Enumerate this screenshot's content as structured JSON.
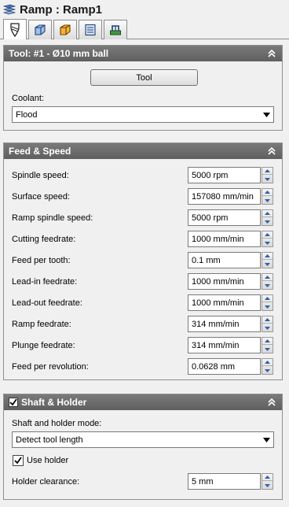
{
  "window": {
    "title": "Ramp : Ramp1",
    "icon": "ramp-layers-icon"
  },
  "tabs": [
    {
      "name": "tool-tab",
      "icon": "tool-bit-icon",
      "active": true
    },
    {
      "name": "geometry-tab",
      "icon": "cube-wireframe-icon",
      "active": false
    },
    {
      "name": "stock-tab",
      "icon": "stock-block-icon",
      "active": false
    },
    {
      "name": "passes-tab",
      "icon": "passes-list-icon",
      "active": false
    },
    {
      "name": "linking-tab",
      "icon": "linking-icon",
      "active": false
    }
  ],
  "tool_panel": {
    "header": "Tool: #1 - Ø10 mm ball",
    "tool_button": "Tool",
    "coolant_label": "Coolant:",
    "coolant_value": "Flood"
  },
  "feed_panel": {
    "header": "Feed & Speed",
    "rows": [
      {
        "label": "Spindle speed:",
        "value": "5000 rpm"
      },
      {
        "label": "Surface speed:",
        "value": "157080 mm/min"
      },
      {
        "label": "Ramp spindle speed:",
        "value": "5000 rpm"
      },
      {
        "label": "Cutting feedrate:",
        "value": "1000 mm/min"
      },
      {
        "label": "Feed per tooth:",
        "value": "0.1 mm"
      },
      {
        "label": "Lead-in feedrate:",
        "value": "1000 mm/min"
      },
      {
        "label": "Lead-out feedrate:",
        "value": "1000 mm/min"
      },
      {
        "label": "Ramp feedrate:",
        "value": "314 mm/min"
      },
      {
        "label": "Plunge feedrate:",
        "value": "314 mm/min"
      },
      {
        "label": "Feed per revolution:",
        "value": "0.0628 mm"
      }
    ]
  },
  "shaft_panel": {
    "header": "Shaft & Holder",
    "enabled": true,
    "mode_label": "Shaft and holder mode:",
    "mode_value": "Detect tool length",
    "use_holder_label": "Use holder",
    "use_holder_checked": true,
    "clearance_label": "Holder clearance:",
    "clearance_value": "5 mm"
  },
  "colors": {
    "panel_header": "#6b6b6b",
    "background": "#f0f0f0",
    "spin_arrow": "#2f5fa8"
  }
}
